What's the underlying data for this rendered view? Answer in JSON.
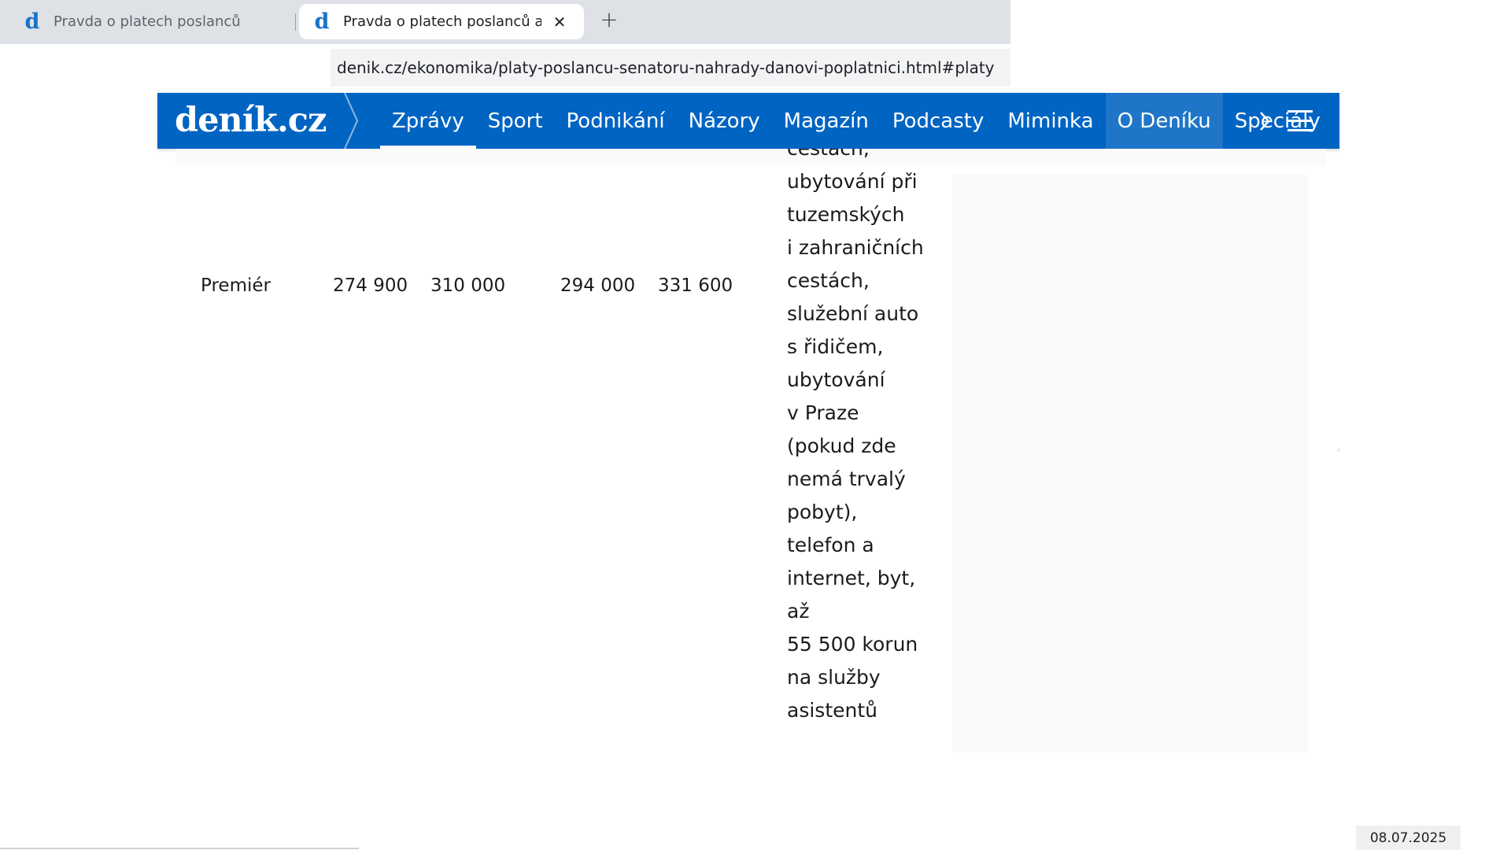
{
  "browser": {
    "tabs": [
      {
        "title": "Pravda o platech poslanců a senátorů",
        "favicon": "d",
        "active": false
      },
      {
        "title": "Pravda o platech poslanců a senátorů",
        "favicon": "d",
        "active": true
      }
    ],
    "close_symbol": "✕",
    "new_tab_symbol": "+",
    "url": "denik.cz/ekonomika/platy-poslancu-senatoru-nahrady-danovi-poplatnici.html#platy"
  },
  "site_nav": {
    "logo": "deník.cz",
    "brand_color": "#0064c3",
    "items": [
      {
        "label": "Zprávy",
        "active": true
      },
      {
        "label": "Sport"
      },
      {
        "label": "Podnikání"
      },
      {
        "label": "Názory"
      },
      {
        "label": "Magazín"
      },
      {
        "label": "Podcasty"
      },
      {
        "label": "Miminka"
      },
      {
        "label": "O Deníku",
        "highlight": true
      },
      {
        "label": "Speciály"
      }
    ],
    "next_icon": "chevron-right-icon",
    "menu_icon": "hamburger-menu-icon"
  },
  "table_row": {
    "position": "Premiér",
    "values": [
      "274 900",
      "310 000",
      "294 000",
      "331 600"
    ],
    "benefits_lines": [
      "cestách,",
      "ubytování při",
      "tuzemských",
      "i zahraničních",
      "cestách,",
      "služební auto",
      "s řidičem,",
      "ubytování",
      "v Praze",
      "(pokud zde",
      "nemá trvalý",
      "pobyt),",
      "telefon a",
      "internet, byt,",
      "až",
      "55 500 korun",
      "na služby",
      "asistentů"
    ]
  },
  "footer": {
    "date": "08.07.2025"
  }
}
